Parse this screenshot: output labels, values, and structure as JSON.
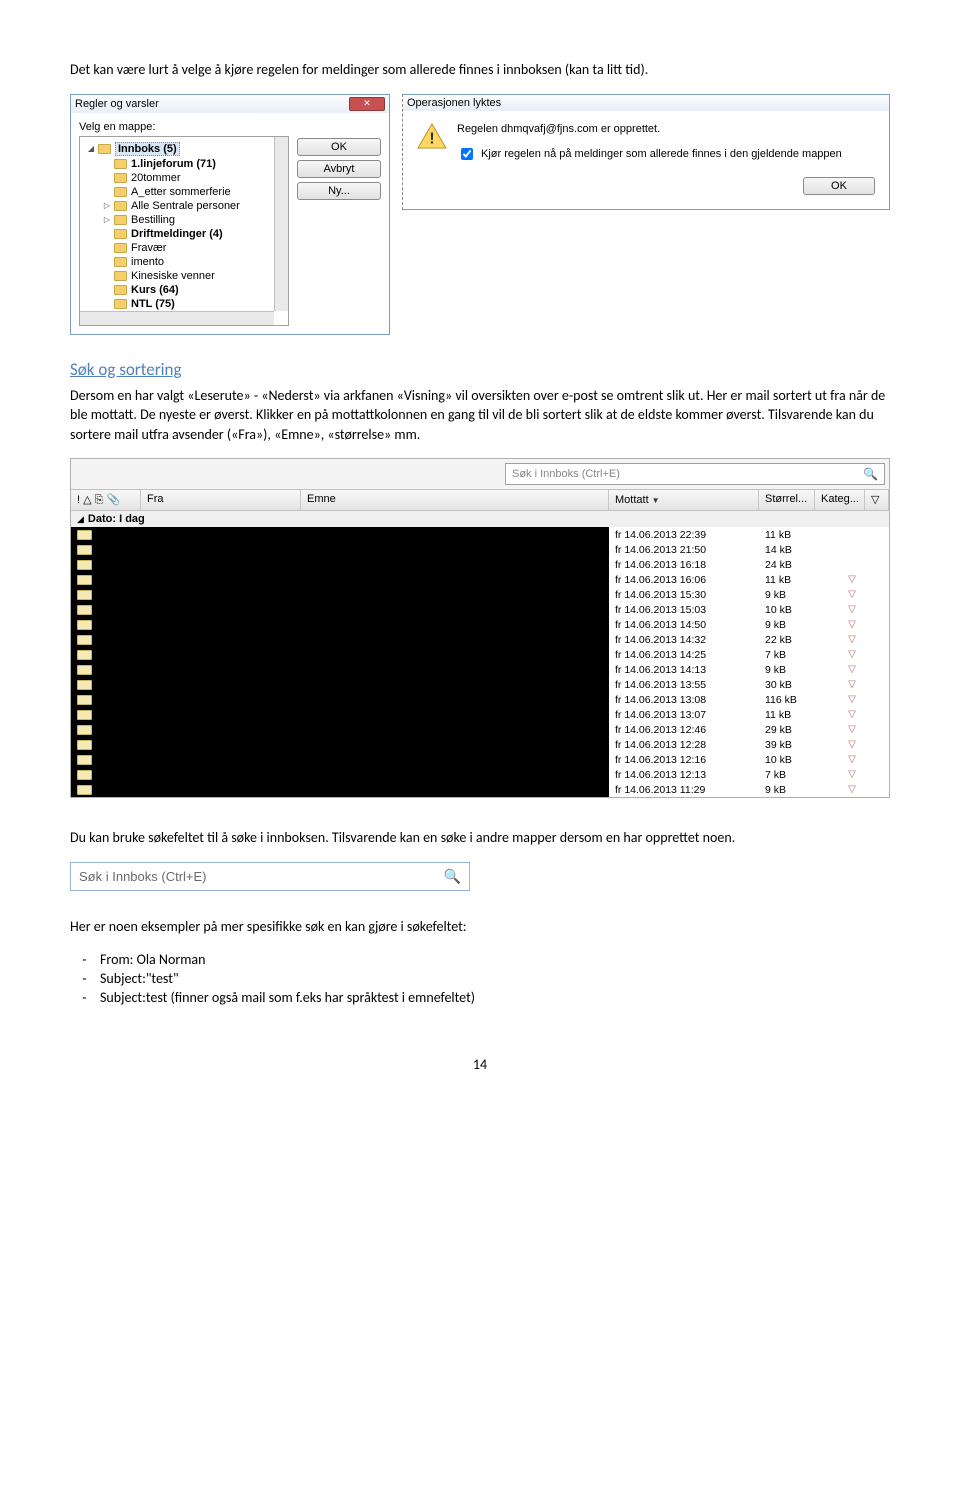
{
  "intro": "Det kan være lurt å velge å kjøre regelen for meldinger som allerede finnes i innboksen (kan ta litt tid).",
  "dlg1": {
    "title": "Regler og varsler",
    "label": "Velg en mappe:",
    "btn_ok": "OK",
    "btn_cancel": "Avbryt",
    "btn_new": "Ny...",
    "folders": [
      {
        "label": "Innboks",
        "count": "(5)",
        "indent": 12,
        "bold": true,
        "selected": true
      },
      {
        "label": "1.linjeforum",
        "count": "(71)",
        "indent": 28,
        "bold": true
      },
      {
        "label": "20tommer",
        "count": "",
        "indent": 28
      },
      {
        "label": "A_etter sommerferie",
        "count": "",
        "indent": 28
      },
      {
        "label": "Alle Sentrale personer",
        "count": "",
        "indent": 28,
        "expander": true
      },
      {
        "label": "Bestilling",
        "count": "",
        "indent": 28,
        "expander": true
      },
      {
        "label": "Driftmeldinger",
        "count": "(4)",
        "indent": 28,
        "bold": true
      },
      {
        "label": "Fravær",
        "count": "",
        "indent": 28
      },
      {
        "label": "imento",
        "count": "",
        "indent": 28
      },
      {
        "label": "Kinesiske venner",
        "count": "",
        "indent": 28
      },
      {
        "label": "Kurs",
        "count": "(64)",
        "indent": 28,
        "bold": true
      },
      {
        "label": "NTL",
        "count": "(75)",
        "indent": 28,
        "bold": true
      }
    ]
  },
  "dlg2": {
    "title": "Operasjonen lyktes",
    "msg": "Regelen dhmqvafj@fjns.com er opprettet.",
    "chk_label": "Kjør regelen nå på meldinger som allerede finnes i den gjeldende mappen",
    "btn_ok": "OK"
  },
  "section_title": "Søk og sortering",
  "section_body": "Dersom en har valgt «Leserute» - «Nederst» via arkfanen «Visning» vil oversikten over e-post se omtrent slik ut. Her er mail sortert ut fra når de ble mottatt. De nyeste er øverst. Klikker en på mottattkolonnen en gang til vil de bli sortert slik at de eldste kommer øverst. Tilsvarende kan du sortere mail utfra avsender («Fra»), «Emne», «størrelse» mm.",
  "inbox": {
    "search_placeholder": "Søk i Innboks (Ctrl+E)",
    "cols": {
      "fra": "Fra",
      "emne": "Emne",
      "mottatt": "Mottatt",
      "size": "Størrel...",
      "kateg": "Kateg..."
    },
    "group_label": "Dato: I dag",
    "rows": [
      {
        "date": "fr 14.06.2013 22:39",
        "size": "11 kB"
      },
      {
        "date": "fr 14.06.2013 21:50",
        "size": "14 kB"
      },
      {
        "date": "fr 14.06.2013 16:18",
        "size": "24 kB"
      },
      {
        "date": "fr 14.06.2013 16:06",
        "size": "11 kB"
      },
      {
        "date": "fr 14.06.2013 15:30",
        "size": "9 kB"
      },
      {
        "date": "fr 14.06.2013 15:03",
        "size": "10 kB"
      },
      {
        "date": "fr 14.06.2013 14:50",
        "size": "9 kB"
      },
      {
        "date": "fr 14.06.2013 14:32",
        "size": "22 kB"
      },
      {
        "date": "fr 14.06.2013 14:25",
        "size": "7 kB"
      },
      {
        "date": "fr 14.06.2013 14:13",
        "size": "9 kB"
      },
      {
        "date": "fr 14.06.2013 13:55",
        "size": "30 kB"
      },
      {
        "date": "fr 14.06.2013 13:08",
        "size": "116 kB"
      },
      {
        "date": "fr 14.06.2013 13:07",
        "size": "11 kB"
      },
      {
        "date": "fr 14.06.2013 12:46",
        "size": "29 kB"
      },
      {
        "date": "fr 14.06.2013 12:28",
        "size": "39 kB"
      },
      {
        "date": "fr 14.06.2013 12:16",
        "size": "10 kB"
      },
      {
        "date": "fr 14.06.2013 12:13",
        "size": "7 kB"
      },
      {
        "date": "fr 14.06.2013 11:29",
        "size": "9 kB"
      }
    ]
  },
  "after_inbox": "Du kan bruke søkefeltet til å søke i innboksen. Tilsvarende kan en søke i andre mapper dersom en har opprettet noen.",
  "search_standalone": "Søk i Innboks (Ctrl+E)",
  "examples_intro": "Her er noen eksempler på mer spesifikke søk en kan gjøre i søkefeltet:",
  "examples": [
    "From: Ola Norman",
    "Subject:\"test\"",
    "Subject:test (finner også mail som f.eks har språktest i emnefeltet)"
  ],
  "page_no": "14"
}
